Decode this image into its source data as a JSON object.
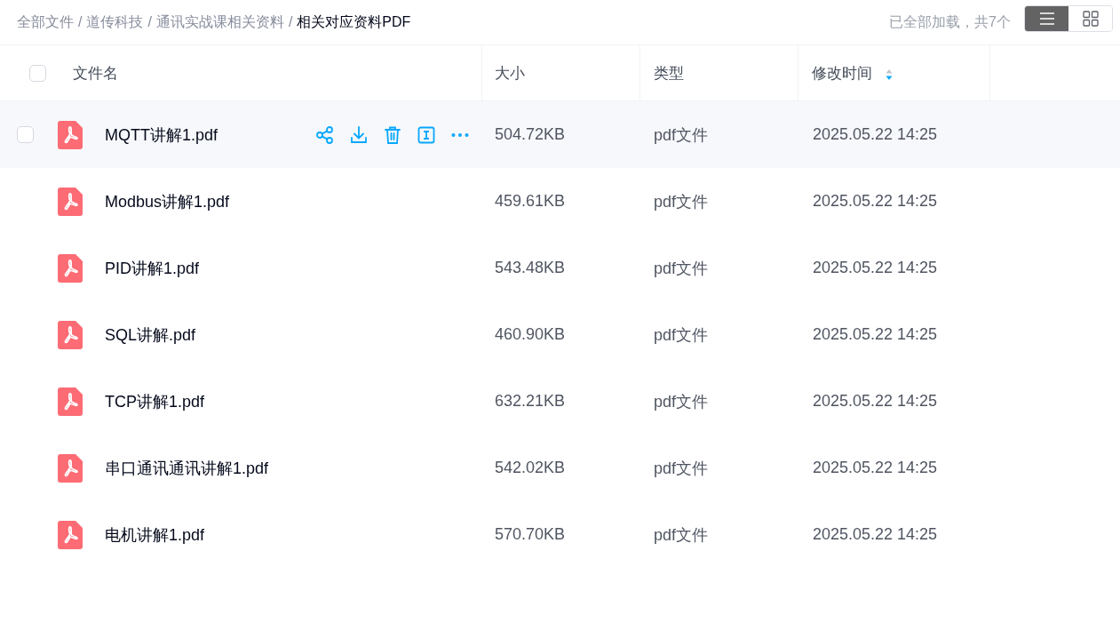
{
  "breadcrumb_separator": "/",
  "breadcrumb": [
    {
      "label": "全部文件",
      "current": false
    },
    {
      "label": "道传科技",
      "current": false
    },
    {
      "label": "通讯实战课相关资料",
      "current": false
    },
    {
      "label": "相关对应资料PDF",
      "current": true
    }
  ],
  "load_status": "已全部加载，共7个",
  "view_toggle": [
    {
      "kind": "list",
      "selected": true
    },
    {
      "kind": "grid",
      "selected": false
    }
  ],
  "table": {
    "select_all": {
      "checked": false
    },
    "columns": [
      {
        "label": "文件名",
        "sorted": false
      },
      {
        "label": "大小",
        "sorted": false
      },
      {
        "label": "类型",
        "sorted": false
      },
      {
        "label": "修改时间",
        "sorted": true
      }
    ],
    "rows": [
      {
        "name": "MQTT讲解1.pdf",
        "size": "504.72KB",
        "type": "pdf文件",
        "modified": "2025.05.22 14:25",
        "hovered": true,
        "checked": false
      },
      {
        "name": "Modbus讲解1.pdf",
        "size": "459.61KB",
        "type": "pdf文件",
        "modified": "2025.05.22 14:25",
        "hovered": false,
        "checked": false
      },
      {
        "name": "PID讲解1.pdf",
        "size": "543.48KB",
        "type": "pdf文件",
        "modified": "2025.05.22 14:25",
        "hovered": false,
        "checked": false
      },
      {
        "name": "SQL讲解.pdf",
        "size": "460.90KB",
        "type": "pdf文件",
        "modified": "2025.05.22 14:25",
        "hovered": false,
        "checked": false
      },
      {
        "name": "TCP讲解1.pdf",
        "size": "632.21KB",
        "type": "pdf文件",
        "modified": "2025.05.22 14:25",
        "hovered": false,
        "checked": false
      },
      {
        "name": "串口通讯通讯讲解1.pdf",
        "size": "542.02KB",
        "type": "pdf文件",
        "modified": "2025.05.22 14:25",
        "hovered": false,
        "checked": false
      },
      {
        "name": "电机讲解1.pdf",
        "size": "570.70KB",
        "type": "pdf文件",
        "modified": "2025.05.22 14:25",
        "hovered": false,
        "checked": false
      }
    ]
  }
}
